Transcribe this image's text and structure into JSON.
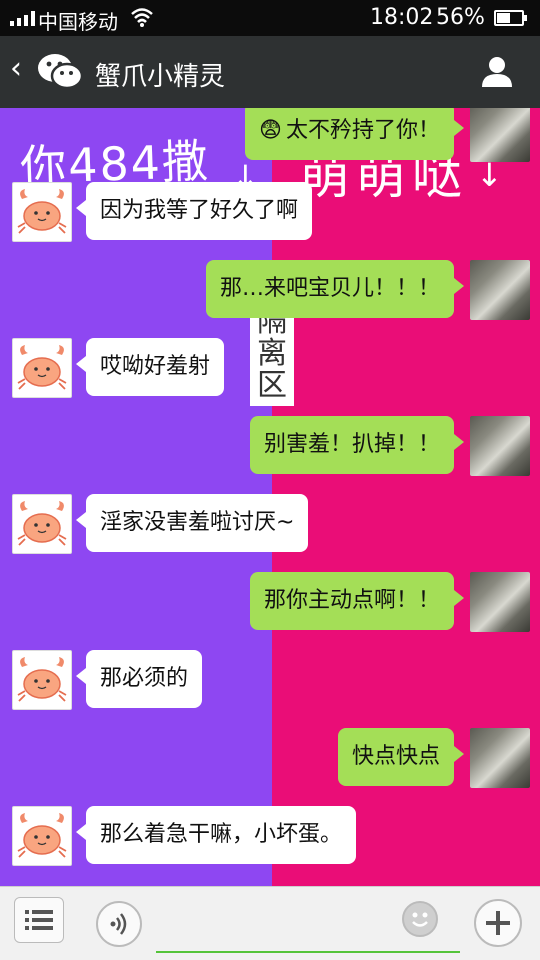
{
  "status_bar": {
    "carrier": "中国移动",
    "time": "18:02",
    "battery_percent": "56%",
    "battery_level": 0.56,
    "signal_icon": "signal-bars-icon",
    "wifi_icon": "wifi-icon"
  },
  "nav": {
    "back_icon": "chevron-left-icon",
    "app_icon": "wechat-icon",
    "title": "蟹爪小精灵",
    "profile_icon": "person-icon"
  },
  "background": {
    "left_color": "#8e47f2",
    "right_color": "#ea0d77",
    "left_text": "你484撒",
    "right_text": "萌萌哒",
    "divider_text": "隔离区"
  },
  "messages": [
    {
      "side": "out",
      "text": "太不矜持了你！",
      "emoji": "😨"
    },
    {
      "side": "in",
      "text": "因为我等了好久了啊"
    },
    {
      "side": "out",
      "text": "那…来吧宝贝儿！！！"
    },
    {
      "side": "in",
      "text": "哎呦好羞射"
    },
    {
      "side": "out",
      "text": "别害羞！扒掉！！"
    },
    {
      "side": "in",
      "text": "淫家没害羞啦讨厌~"
    },
    {
      "side": "out",
      "text": "那你主动点啊！！"
    },
    {
      "side": "in",
      "text": "那必须的"
    },
    {
      "side": "out",
      "text": "快点快点"
    },
    {
      "side": "in",
      "text": "那么着急干嘛，小坏蛋。"
    }
  ],
  "toolbar": {
    "menu_icon": "menu-icon",
    "voice_icon": "voice-icon",
    "input_value": "",
    "emoji_icon": "smiley-icon",
    "plus_icon": "plus-icon"
  },
  "colors": {
    "accent_green": "#a4de57",
    "nav_bg": "#2e3132",
    "input_underline": "#55c43a"
  }
}
